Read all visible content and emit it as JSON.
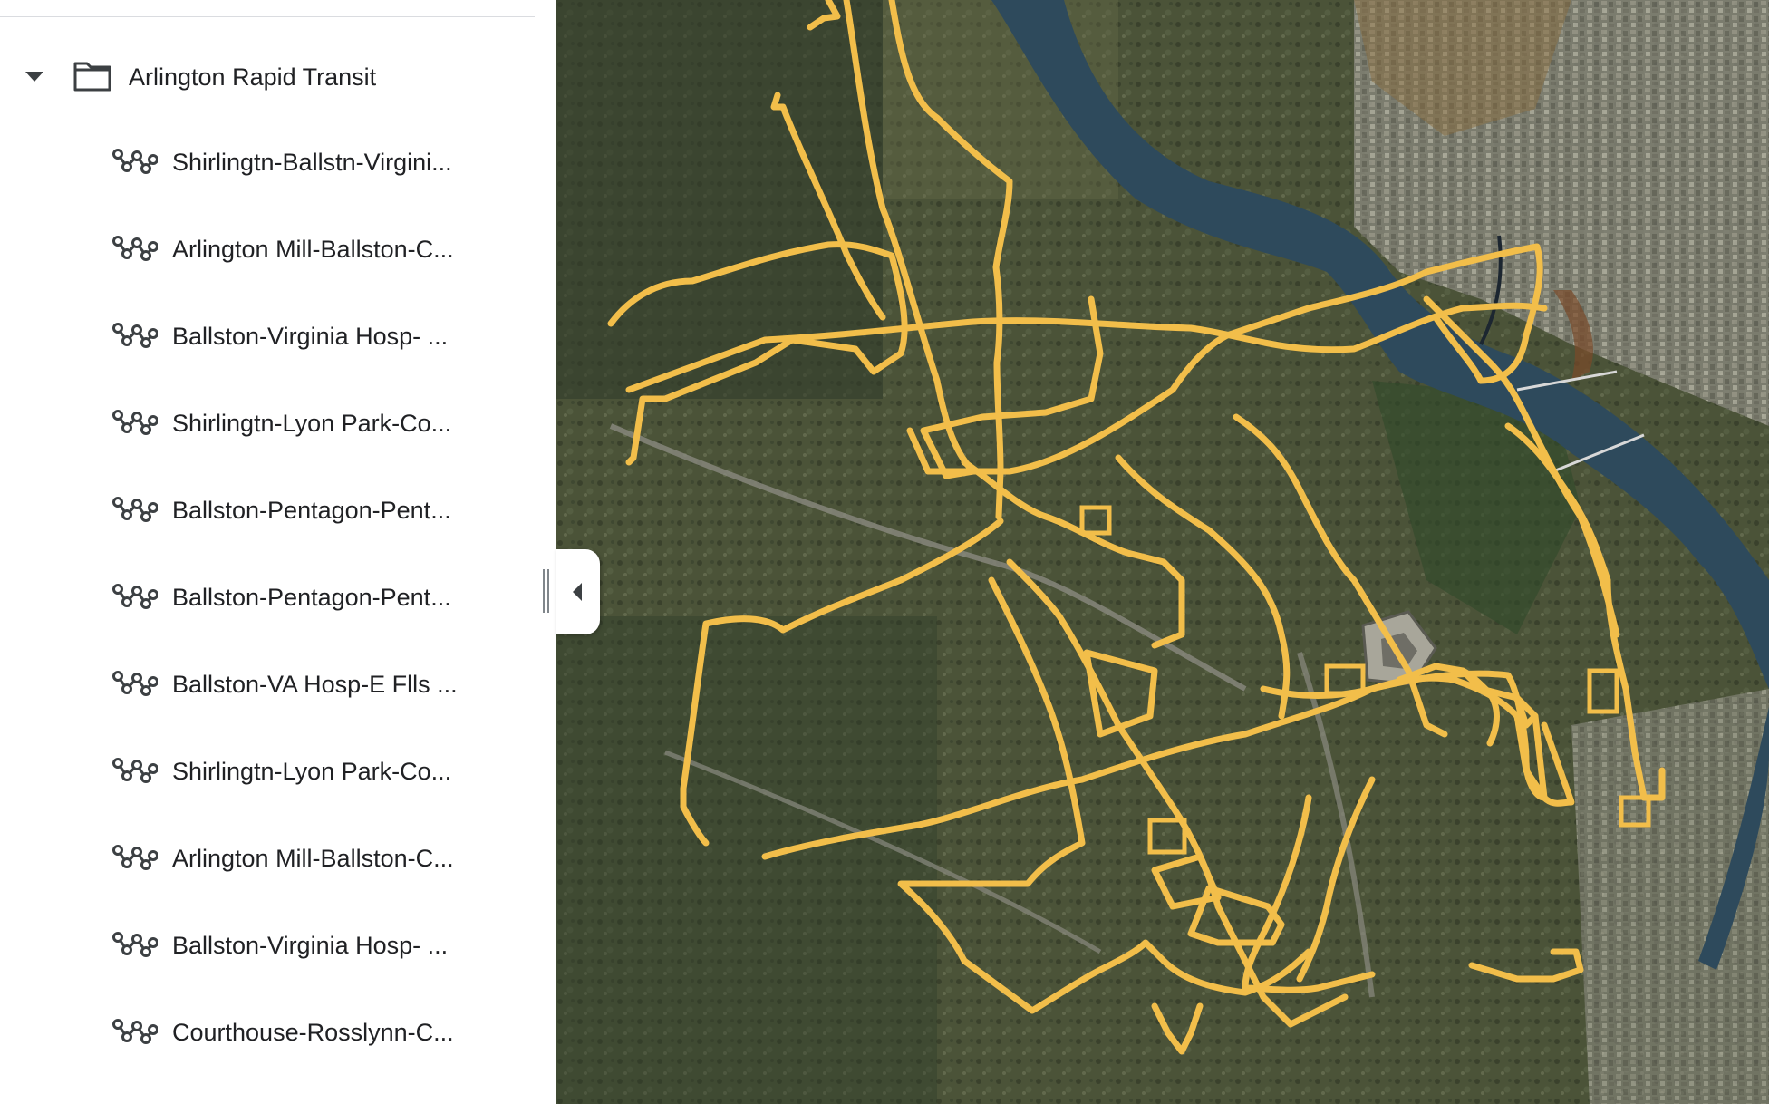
{
  "sidebar": {
    "folder": {
      "label": "Arlington Rapid Transit",
      "icon": "folder-icon",
      "expanded": true
    },
    "layers": [
      {
        "label": "Shirlingtn-Ballstn-Virgini...",
        "icon": "route-icon"
      },
      {
        "label": "Arlington Mill-Ballston-C...",
        "icon": "route-icon"
      },
      {
        "label": "Ballston-Virginia Hosp- ...",
        "icon": "route-icon"
      },
      {
        "label": "Shirlingtn-Lyon Park-Co...",
        "icon": "route-icon"
      },
      {
        "label": "Ballston-Pentagon-Pent...",
        "icon": "route-icon"
      },
      {
        "label": "Ballston-Pentagon-Pent...",
        "icon": "route-icon"
      },
      {
        "label": "Ballston-VA Hosp-E Flls ...",
        "icon": "route-icon"
      },
      {
        "label": "Shirlingtn-Lyon Park-Co...",
        "icon": "route-icon"
      },
      {
        "label": "Arlington Mill-Ballston-C...",
        "icon": "route-icon"
      },
      {
        "label": "Ballston-Virginia Hosp- ...",
        "icon": "route-icon"
      },
      {
        "label": "Courthouse-Rosslynn-C...",
        "icon": "route-icon"
      }
    ]
  },
  "map": {
    "basemap": "satellite",
    "route_color": "#F2BE4A",
    "river_color": "#2E4A5C"
  }
}
